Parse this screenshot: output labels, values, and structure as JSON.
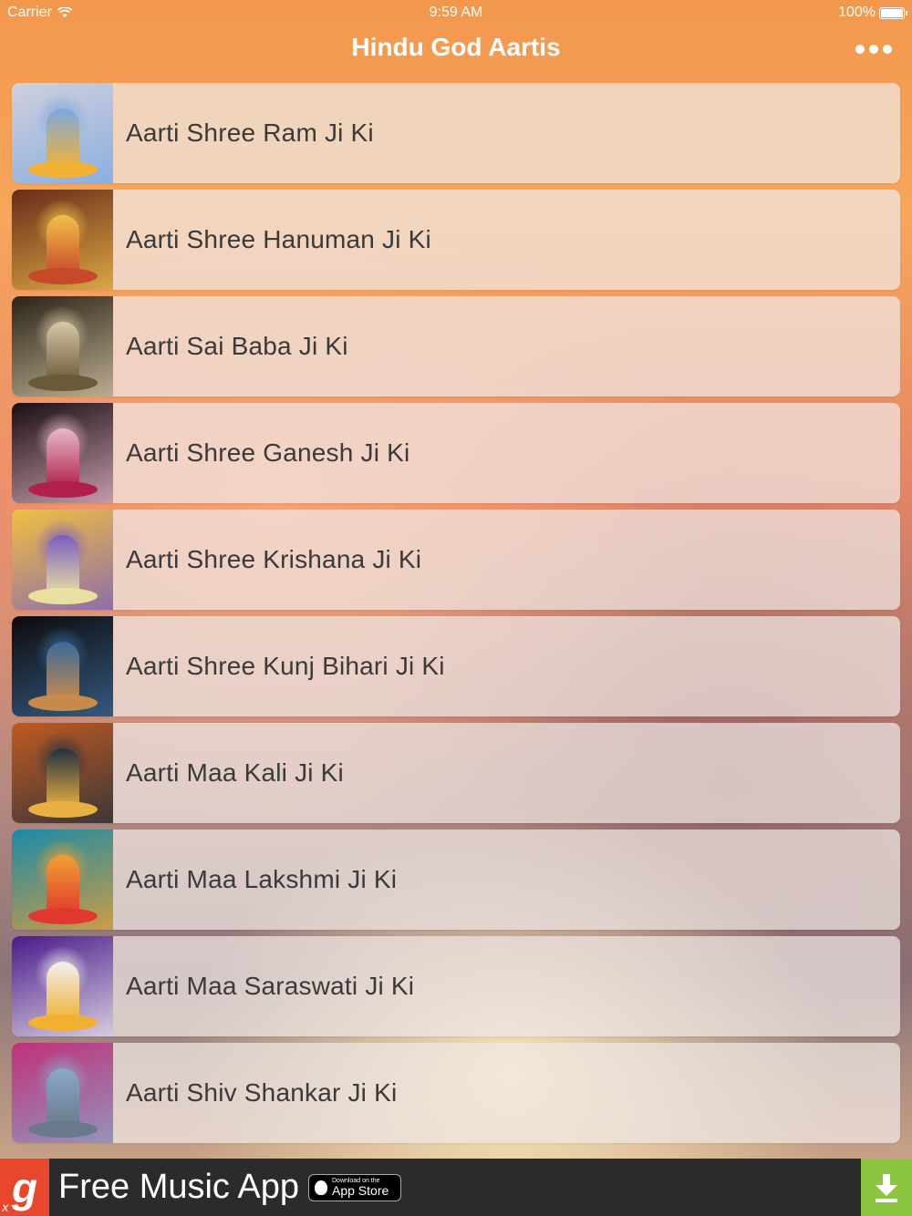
{
  "status_bar": {
    "carrier": "Carrier",
    "time": "9:59 AM",
    "battery": "100%"
  },
  "nav": {
    "title": "Hindu God Aartis",
    "more_icon": "more-dots-icon"
  },
  "list": [
    {
      "label": "Aarti Shree Ram Ji Ki",
      "colors": [
        "#cfd0dc",
        "#7ea8e0",
        "#f2b233"
      ]
    },
    {
      "label": "Aarti Shree Hanuman Ji Ki",
      "colors": [
        "#6a2a1a",
        "#f2c04a",
        "#c64a2a"
      ]
    },
    {
      "label": "Aarti Sai Baba Ji Ki",
      "colors": [
        "#2a2418",
        "#d9c8a8",
        "#6b5a3a"
      ]
    },
    {
      "label": "Aarti Shree Ganesh Ji Ki",
      "colors": [
        "#1a0d14",
        "#e6b8c8",
        "#b0204a"
      ]
    },
    {
      "label": "Aarti Shree Krishana Ji Ki",
      "colors": [
        "#f0c040",
        "#7b5cc0",
        "#e8e0a0"
      ]
    },
    {
      "label": "Aarti Shree Kunj Bihari Ji Ki",
      "colors": [
        "#0d0a0a",
        "#3a6a9a",
        "#c88a4a"
      ]
    },
    {
      "label": "Aarti Maa Kali Ji Ki",
      "colors": [
        "#c05a20",
        "#223040",
        "#e8b040"
      ]
    },
    {
      "label": "Aarti Maa Lakshmi Ji Ki",
      "colors": [
        "#1a8aa8",
        "#f0a030",
        "#e03a30"
      ]
    },
    {
      "label": "Aarti Maa Saraswati Ji Ki",
      "colors": [
        "#4a1a8a",
        "#f0f0f0",
        "#f0b030"
      ]
    },
    {
      "label": "Aarti Shiv Shankar Ji Ki",
      "colors": [
        "#c0307a",
        "#8aa8c8",
        "#6a7a8a"
      ]
    }
  ],
  "ad": {
    "logo": "g",
    "text": "Free Music App",
    "badge_small": "Download on the",
    "badge_big": "App Store",
    "download_icon": "download-icon",
    "close": "X"
  }
}
